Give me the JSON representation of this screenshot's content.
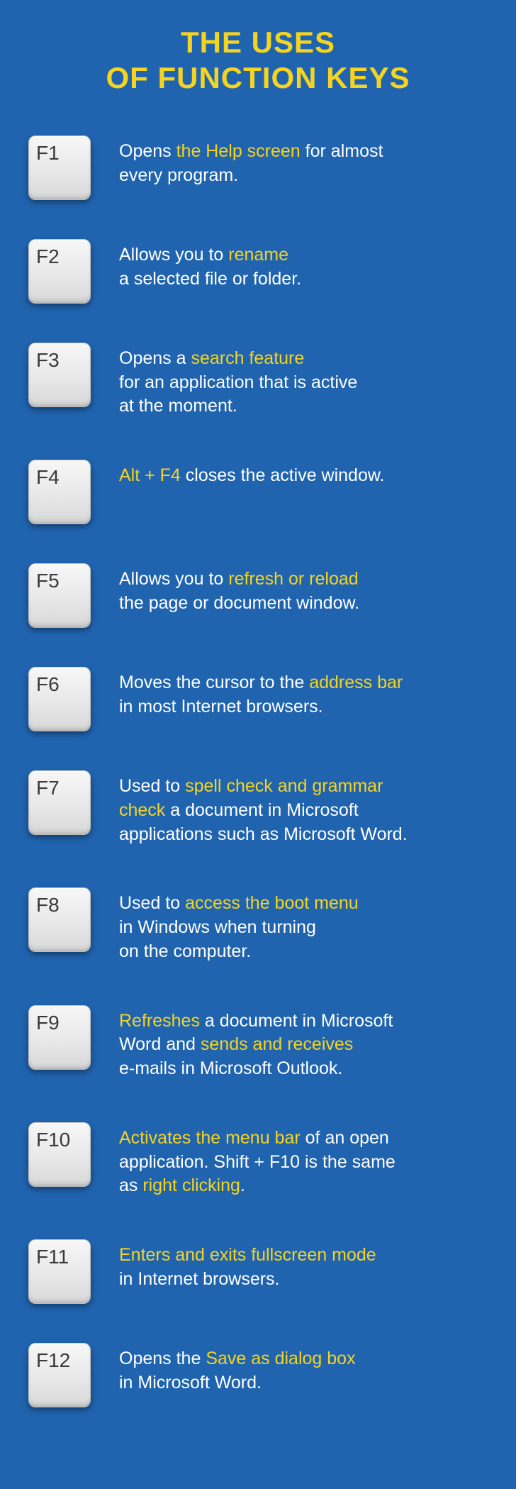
{
  "title_line1": "THE USES",
  "title_line2": "OF FUNCTION KEYS",
  "keys": [
    {
      "label": "F1",
      "segments": [
        {
          "t": "Opens ",
          "hl": false
        },
        {
          "t": "the Help screen",
          "hl": true
        },
        {
          "t": " for almost\nevery program.",
          "hl": false
        }
      ]
    },
    {
      "label": "F2",
      "segments": [
        {
          "t": "Allows you to ",
          "hl": false
        },
        {
          "t": "rename",
          "hl": true
        },
        {
          "t": "\na selected file or folder.",
          "hl": false
        }
      ]
    },
    {
      "label": "F3",
      "segments": [
        {
          "t": "Opens a ",
          "hl": false
        },
        {
          "t": "search feature",
          "hl": true
        },
        {
          "t": "\nfor an application that is active\nat the moment.",
          "hl": false
        }
      ]
    },
    {
      "label": "F4",
      "segments": [
        {
          "t": "Alt + F4",
          "hl": true
        },
        {
          "t": " closes the active window.",
          "hl": false
        }
      ]
    },
    {
      "label": "F5",
      "segments": [
        {
          "t": "Allows you to ",
          "hl": false
        },
        {
          "t": "refresh or reload",
          "hl": true
        },
        {
          "t": "\nthe page or document window.",
          "hl": false
        }
      ]
    },
    {
      "label": "F6",
      "segments": [
        {
          "t": "Moves the cursor to the ",
          "hl": false
        },
        {
          "t": "address bar",
          "hl": true
        },
        {
          "t": "\nin most Internet browsers.",
          "hl": false
        }
      ]
    },
    {
      "label": "F7",
      "segments": [
        {
          "t": "Used to ",
          "hl": false
        },
        {
          "t": "spell check and grammar\ncheck",
          "hl": true
        },
        {
          "t": " a document in Microsoft\napplications such as Microsoft Word.",
          "hl": false
        }
      ]
    },
    {
      "label": "F8",
      "segments": [
        {
          "t": "Used to ",
          "hl": false
        },
        {
          "t": "access the boot menu",
          "hl": true
        },
        {
          "t": "\nin Windows when turning\non the computer.",
          "hl": false
        }
      ]
    },
    {
      "label": "F9",
      "segments": [
        {
          "t": "Refreshes",
          "hl": true
        },
        {
          "t": " a document in Microsoft\nWord and ",
          "hl": false
        },
        {
          "t": "sends and receives",
          "hl": true
        },
        {
          "t": "\ne-mails in Microsoft Outlook.",
          "hl": false
        }
      ]
    },
    {
      "label": "F10",
      "segments": [
        {
          "t": "Activates the menu bar",
          "hl": true
        },
        {
          "t": " of an open\napplication. Shift + F10 is the same\nas ",
          "hl": false
        },
        {
          "t": "right clicking",
          "hl": true
        },
        {
          "t": ".",
          "hl": false
        }
      ]
    },
    {
      "label": "F11",
      "segments": [
        {
          "t": "Enters and exits fullscreen mode",
          "hl": true
        },
        {
          "t": "\nin Internet browsers.",
          "hl": false
        }
      ]
    },
    {
      "label": "F12",
      "segments": [
        {
          "t": "Opens the ",
          "hl": false
        },
        {
          "t": "Save as dialog box",
          "hl": true
        },
        {
          "t": "\nin Microsoft Word.",
          "hl": false
        }
      ]
    }
  ]
}
